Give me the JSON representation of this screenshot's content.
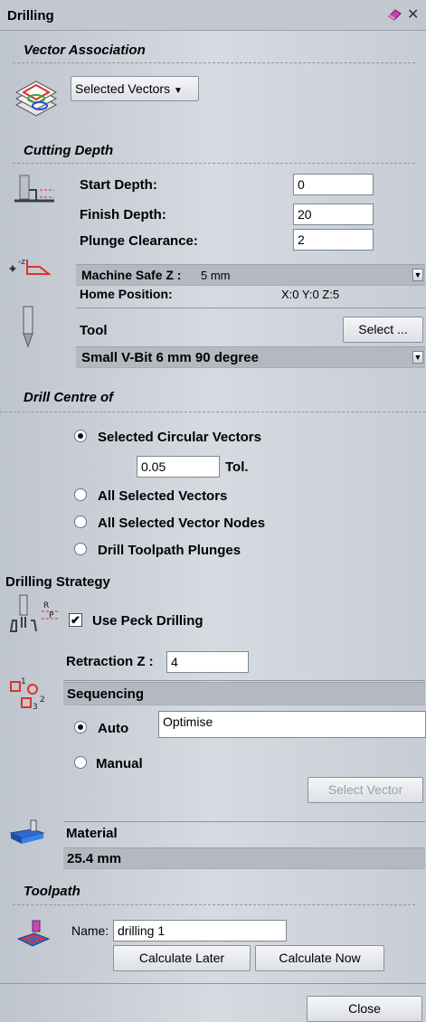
{
  "title": "Drilling",
  "vector_association": {
    "header": "Vector Association",
    "dropdown": "Selected Vectors"
  },
  "cutting_depth": {
    "header": "Cutting Depth",
    "start_label": "Start Depth:",
    "start_value": "0",
    "finish_label": "Finish Depth:",
    "finish_value": "20",
    "plunge_label": "Plunge Clearance:",
    "plunge_value": "2",
    "machine_safe_label": "Machine Safe Z :",
    "machine_safe_value": "5 mm",
    "home_label": "Home Position:",
    "home_value": "X:0 Y:0 Z:5",
    "tool_label": "Tool",
    "select_button": "Select ...",
    "tool_name": "Small V-Bit 6 mm 90 degree"
  },
  "drill_centre": {
    "header": "Drill Centre of",
    "options": [
      "Selected Circular Vectors",
      "All Selected Vectors",
      "All Selected Vector Nodes",
      "Drill Toolpath Plunges"
    ],
    "selected_index": 0,
    "tol_value": "0.05",
    "tol_label": "Tol."
  },
  "drilling_strategy": {
    "header": "Drilling Strategy",
    "peck_label": "Use Peck Drilling",
    "peck_checked": true,
    "retraction_label": "Retraction Z :",
    "retraction_value": "4",
    "sequencing_label": "Sequencing",
    "auto_label": "Auto",
    "auto_value": "Optimise",
    "manual_label": "Manual",
    "select_vector_button": "Select Vector"
  },
  "material": {
    "label": "Material",
    "value": "25.4 mm"
  },
  "toolpath": {
    "header": "Toolpath",
    "name_label": "Name:",
    "name_value": "drilling 1",
    "calc_later": "Calculate Later",
    "calc_now": "Calculate Now"
  },
  "close_button": "Close",
  "icons": [
    "eraser-icon",
    "close-icon",
    "layers-icon",
    "depth-icon",
    "safe-z-icon",
    "tool-bit-icon",
    "peck-drill-icon",
    "sequence-icon",
    "material-icon",
    "toolpath-icon",
    "dropdown-arrow-icon"
  ]
}
